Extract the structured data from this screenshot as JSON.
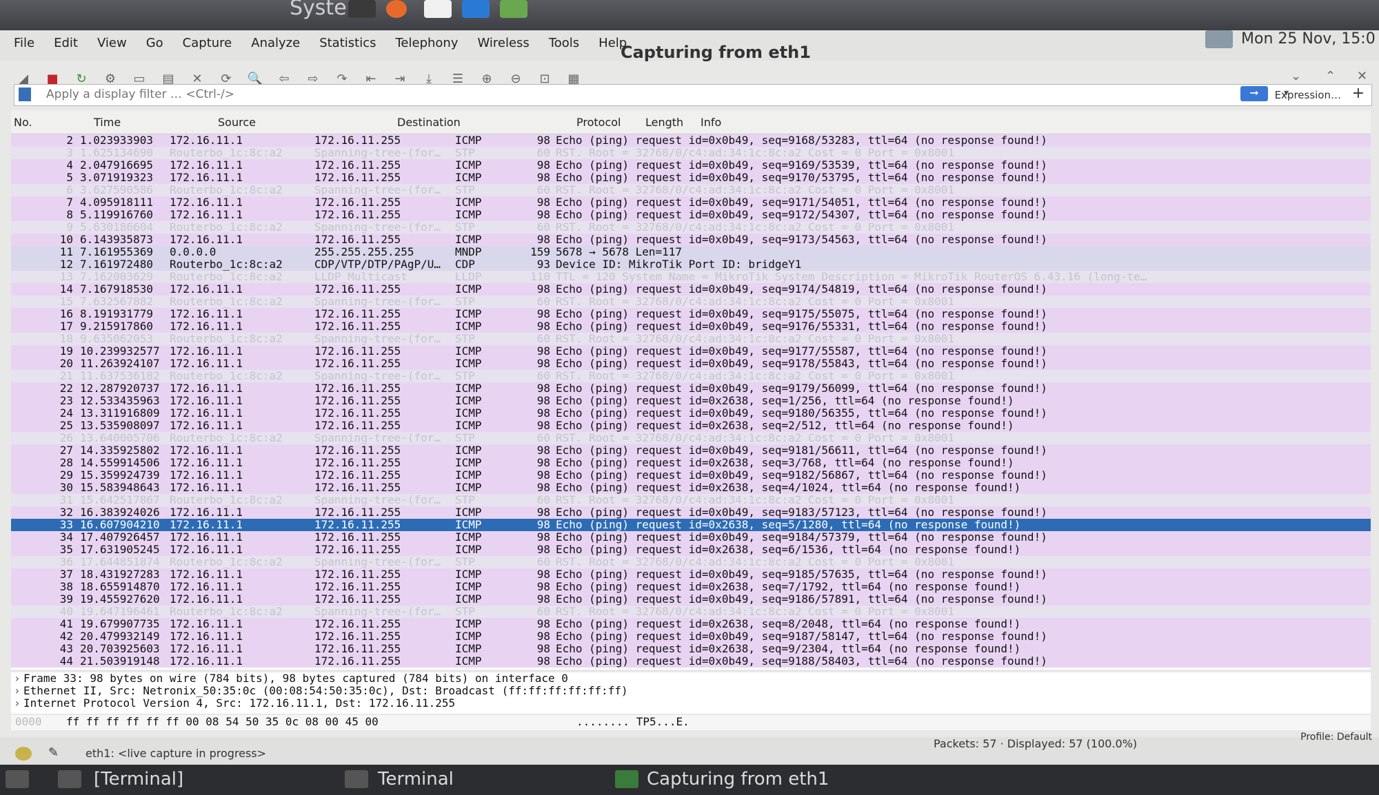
{
  "topbar": {
    "app_title": "System",
    "clock": "Mon 25 Nov, 15:0"
  },
  "window": {
    "title": "Capturing from eth1",
    "menu": [
      "File",
      "Edit",
      "View",
      "Go",
      "Capture",
      "Analyze",
      "Statistics",
      "Telephony",
      "Wireless",
      "Tools",
      "Help"
    ]
  },
  "filter": {
    "placeholder": "Apply a display filter … <Ctrl-/>",
    "expression_label": "Expression…",
    "plus_label": "+"
  },
  "columns": {
    "no": "No.",
    "time": "Time",
    "source": "Source",
    "destination": "Destination",
    "protocol": "Protocol",
    "length": "Length",
    "info": "Info"
  },
  "packets": [
    {
      "no": "2",
      "time": "1.023933903",
      "src": "172.16.11.1",
      "dst": "172.16.11.255",
      "proto": "ICMP",
      "len": "98",
      "info": "Echo (ping) request  id=0x0b49, seq=9168/53283, ttl=64 (no response found!)",
      "kind": "icmp"
    },
    {
      "no": "3",
      "time": "1.625134690",
      "src": "Routerbo_1c:8c:a2",
      "dst": "Spanning-tree-(for…",
      "proto": "STP",
      "len": "60",
      "info": "RST. Root = 32768/0/c4:ad:34:1c:8c:a2  Cost = 0  Port = 0x8001",
      "kind": "stp"
    },
    {
      "no": "4",
      "time": "2.047916695",
      "src": "172.16.11.1",
      "dst": "172.16.11.255",
      "proto": "ICMP",
      "len": "98",
      "info": "Echo (ping) request  id=0x0b49, seq=9169/53539, ttl=64 (no response found!)",
      "kind": "icmp"
    },
    {
      "no": "5",
      "time": "3.071919323",
      "src": "172.16.11.1",
      "dst": "172.16.11.255",
      "proto": "ICMP",
      "len": "98",
      "info": "Echo (ping) request  id=0x0b49, seq=9170/53795, ttl=64 (no response found!)",
      "kind": "icmp"
    },
    {
      "no": "6",
      "time": "3.627590586",
      "src": "Routerbo_1c:8c:a2",
      "dst": "Spanning-tree-(for…",
      "proto": "STP",
      "len": "60",
      "info": "RST. Root = 32768/0/c4:ad:34:1c:8c:a2  Cost = 0  Port = 0x8001",
      "kind": "stp"
    },
    {
      "no": "7",
      "time": "4.095918111",
      "src": "172.16.11.1",
      "dst": "172.16.11.255",
      "proto": "ICMP",
      "len": "98",
      "info": "Echo (ping) request  id=0x0b49, seq=9171/54051, ttl=64 (no response found!)",
      "kind": "icmp"
    },
    {
      "no": "8",
      "time": "5.119916760",
      "src": "172.16.11.1",
      "dst": "172.16.11.255",
      "proto": "ICMP",
      "len": "98",
      "info": "Echo (ping) request  id=0x0b49, seq=9172/54307, ttl=64 (no response found!)",
      "kind": "icmp"
    },
    {
      "no": "9",
      "time": "5.630186604",
      "src": "Routerbo_1c:8c:a2",
      "dst": "Spanning-tree-(for…",
      "proto": "STP",
      "len": "60",
      "info": "RST. Root = 32768/0/c4:ad:34:1c:8c:a2  Cost = 0  Port = 0x8001",
      "kind": "stp"
    },
    {
      "no": "10",
      "time": "6.143935873",
      "src": "172.16.11.1",
      "dst": "172.16.11.255",
      "proto": "ICMP",
      "len": "98",
      "info": "Echo (ping) request  id=0x0b49, seq=9173/54563, ttl=64 (no response found!)",
      "kind": "icmp"
    },
    {
      "no": "11",
      "time": "7.161955369",
      "src": "0.0.0.0",
      "dst": "255.255.255.255",
      "proto": "MNDP",
      "len": "159",
      "info": "5678 → 5678 Len=117",
      "kind": "mndp"
    },
    {
      "no": "12",
      "time": "7.161972480",
      "src": "Routerbo_1c:8c:a2",
      "dst": "CDP/VTP/DTP/PAgP/U…",
      "proto": "CDP",
      "len": "93",
      "info": "Device ID: MikroTik  Port ID: bridgeY1",
      "kind": "cdp"
    },
    {
      "no": "13",
      "time": "7.162003629",
      "src": "Routerbo_1c:8c:a2",
      "dst": "LLDP_Multicast",
      "proto": "LLDP",
      "len": "110",
      "info": "TTL = 120 System Name = MikroTik System Description = MikroTik RouterOS 6.43.16 (long-te…",
      "kind": "lldp"
    },
    {
      "no": "14",
      "time": "7.167918530",
      "src": "172.16.11.1",
      "dst": "172.16.11.255",
      "proto": "ICMP",
      "len": "98",
      "info": "Echo (ping) request  id=0x0b49, seq=9174/54819, ttl=64 (no response found!)",
      "kind": "icmp"
    },
    {
      "no": "15",
      "time": "7.632567882",
      "src": "Routerbo_1c:8c:a2",
      "dst": "Spanning-tree-(for…",
      "proto": "STP",
      "len": "60",
      "info": "RST. Root = 32768/0/c4:ad:34:1c:8c:a2  Cost = 0  Port = 0x8001",
      "kind": "stp"
    },
    {
      "no": "16",
      "time": "8.191931779",
      "src": "172.16.11.1",
      "dst": "172.16.11.255",
      "proto": "ICMP",
      "len": "98",
      "info": "Echo (ping) request  id=0x0b49, seq=9175/55075, ttl=64 (no response found!)",
      "kind": "icmp"
    },
    {
      "no": "17",
      "time": "9.215917860",
      "src": "172.16.11.1",
      "dst": "172.16.11.255",
      "proto": "ICMP",
      "len": "98",
      "info": "Echo (ping) request  id=0x0b49, seq=9176/55331, ttl=64 (no response found!)",
      "kind": "icmp"
    },
    {
      "no": "18",
      "time": "9.635062053",
      "src": "Routerbo_1c:8c:a2",
      "dst": "Spanning-tree-(for…",
      "proto": "STP",
      "len": "60",
      "info": "RST. Root = 32768/0/c4:ad:34:1c:8c:a2  Cost = 0  Port = 0x8001",
      "kind": "stp"
    },
    {
      "no": "19",
      "time": "10.239932577",
      "src": "172.16.11.1",
      "dst": "172.16.11.255",
      "proto": "ICMP",
      "len": "98",
      "info": "Echo (ping) request  id=0x0b49, seq=9177/55587, ttl=64 (no response found!)",
      "kind": "icmp"
    },
    {
      "no": "20",
      "time": "11.263924107",
      "src": "172.16.11.1",
      "dst": "172.16.11.255",
      "proto": "ICMP",
      "len": "98",
      "info": "Echo (ping) request  id=0x0b49, seq=9178/55843, ttl=64 (no response found!)",
      "kind": "icmp"
    },
    {
      "no": "21",
      "time": "11.637536182",
      "src": "Routerbo_1c:8c:a2",
      "dst": "Spanning-tree-(for…",
      "proto": "STP",
      "len": "60",
      "info": "RST. Root = 32768/0/c4:ad:34:1c:8c:a2  Cost = 0  Port = 0x8001",
      "kind": "stp"
    },
    {
      "no": "22",
      "time": "12.287920737",
      "src": "172.16.11.1",
      "dst": "172.16.11.255",
      "proto": "ICMP",
      "len": "98",
      "info": "Echo (ping) request  id=0x0b49, seq=9179/56099, ttl=64 (no response found!)",
      "kind": "icmp"
    },
    {
      "no": "23",
      "time": "12.533435963",
      "src": "172.16.11.1",
      "dst": "172.16.11.255",
      "proto": "ICMP",
      "len": "98",
      "info": "Echo (ping) request  id=0x2638, seq=1/256, ttl=64 (no response found!)",
      "kind": "icmp"
    },
    {
      "no": "24",
      "time": "13.311916809",
      "src": "172.16.11.1",
      "dst": "172.16.11.255",
      "proto": "ICMP",
      "len": "98",
      "info": "Echo (ping) request  id=0x0b49, seq=9180/56355, ttl=64 (no response found!)",
      "kind": "icmp"
    },
    {
      "no": "25",
      "time": "13.535908097",
      "src": "172.16.11.1",
      "dst": "172.16.11.255",
      "proto": "ICMP",
      "len": "98",
      "info": "Echo (ping) request  id=0x2638, seq=2/512, ttl=64 (no response found!)",
      "kind": "icmp"
    },
    {
      "no": "26",
      "time": "13.640005706",
      "src": "Routerbo_1c:8c:a2",
      "dst": "Spanning-tree-(for…",
      "proto": "STP",
      "len": "60",
      "info": "RST. Root = 32768/0/c4:ad:34:1c:8c:a2  Cost = 0  Port = 0x8001",
      "kind": "stp"
    },
    {
      "no": "27",
      "time": "14.335925802",
      "src": "172.16.11.1",
      "dst": "172.16.11.255",
      "proto": "ICMP",
      "len": "98",
      "info": "Echo (ping) request  id=0x0b49, seq=9181/56611, ttl=64 (no response found!)",
      "kind": "icmp"
    },
    {
      "no": "28",
      "time": "14.559914506",
      "src": "172.16.11.1",
      "dst": "172.16.11.255",
      "proto": "ICMP",
      "len": "98",
      "info": "Echo (ping) request  id=0x2638, seq=3/768, ttl=64 (no response found!)",
      "kind": "icmp"
    },
    {
      "no": "29",
      "time": "15.359924739",
      "src": "172.16.11.1",
      "dst": "172.16.11.255",
      "proto": "ICMP",
      "len": "98",
      "info": "Echo (ping) request  id=0x0b49, seq=9182/56867, ttl=64 (no response found!)",
      "kind": "icmp"
    },
    {
      "no": "30",
      "time": "15.583948643",
      "src": "172.16.11.1",
      "dst": "172.16.11.255",
      "proto": "ICMP",
      "len": "98",
      "info": "Echo (ping) request  id=0x2638, seq=4/1024, ttl=64 (no response found!)",
      "kind": "icmp"
    },
    {
      "no": "31",
      "time": "15.642517867",
      "src": "Routerbo_1c:8c:a2",
      "dst": "Spanning-tree-(for…",
      "proto": "STP",
      "len": "60",
      "info": "RST. Root = 32768/0/c4:ad:34:1c:8c:a2  Cost = 0  Port = 0x8001",
      "kind": "stp"
    },
    {
      "no": "32",
      "time": "16.383924026",
      "src": "172.16.11.1",
      "dst": "172.16.11.255",
      "proto": "ICMP",
      "len": "98",
      "info": "Echo (ping) request  id=0x0b49, seq=9183/57123, ttl=64 (no response found!)",
      "kind": "icmp"
    },
    {
      "no": "33",
      "time": "16.607904210",
      "src": "172.16.11.1",
      "dst": "172.16.11.255",
      "proto": "ICMP",
      "len": "98",
      "info": "Echo (ping) request  id=0x2638, seq=5/1280, ttl=64 (no response found!)",
      "kind": "sel"
    },
    {
      "no": "34",
      "time": "17.407926457",
      "src": "172.16.11.1",
      "dst": "172.16.11.255",
      "proto": "ICMP",
      "len": "98",
      "info": "Echo (ping) request  id=0x0b49, seq=9184/57379, ttl=64 (no response found!)",
      "kind": "icmp"
    },
    {
      "no": "35",
      "time": "17.631905245",
      "src": "172.16.11.1",
      "dst": "172.16.11.255",
      "proto": "ICMP",
      "len": "98",
      "info": "Echo (ping) request  id=0x2638, seq=6/1536, ttl=64 (no response found!)",
      "kind": "icmp"
    },
    {
      "no": "36",
      "time": "17.644851874",
      "src": "Routerbo_1c:8c:a2",
      "dst": "Spanning-tree-(for…",
      "proto": "STP",
      "len": "60",
      "info": "RST. Root = 32768/0/c4:ad:34:1c:8c:a2  Cost = 0  Port = 0x8001",
      "kind": "stp"
    },
    {
      "no": "37",
      "time": "18.431927283",
      "src": "172.16.11.1",
      "dst": "172.16.11.255",
      "proto": "ICMP",
      "len": "98",
      "info": "Echo (ping) request  id=0x0b49, seq=9185/57635, ttl=64 (no response found!)",
      "kind": "icmp"
    },
    {
      "no": "38",
      "time": "18.655914870",
      "src": "172.16.11.1",
      "dst": "172.16.11.255",
      "proto": "ICMP",
      "len": "98",
      "info": "Echo (ping) request  id=0x2638, seq=7/1792, ttl=64 (no response found!)",
      "kind": "icmp"
    },
    {
      "no": "39",
      "time": "19.455927620",
      "src": "172.16.11.1",
      "dst": "172.16.11.255",
      "proto": "ICMP",
      "len": "98",
      "info": "Echo (ping) request  id=0x0b49, seq=9186/57891, ttl=64 (no response found!)",
      "kind": "icmp"
    },
    {
      "no": "40",
      "time": "19.647196461",
      "src": "Routerbo_1c:8c:a2",
      "dst": "Spanning-tree-(for…",
      "proto": "STP",
      "len": "60",
      "info": "RST. Root = 32768/0/c4:ad:34:1c:8c:a2  Cost = 0  Port = 0x8001",
      "kind": "stp"
    },
    {
      "no": "41",
      "time": "19.679907735",
      "src": "172.16.11.1",
      "dst": "172.16.11.255",
      "proto": "ICMP",
      "len": "98",
      "info": "Echo (ping) request  id=0x2638, seq=8/2048, ttl=64 (no response found!)",
      "kind": "icmp"
    },
    {
      "no": "42",
      "time": "20.479932149",
      "src": "172.16.11.1",
      "dst": "172.16.11.255",
      "proto": "ICMP",
      "len": "98",
      "info": "Echo (ping) request  id=0x0b49, seq=9187/58147, ttl=64 (no response found!)",
      "kind": "icmp"
    },
    {
      "no": "43",
      "time": "20.703925603",
      "src": "172.16.11.1",
      "dst": "172.16.11.255",
      "proto": "ICMP",
      "len": "98",
      "info": "Echo (ping) request  id=0x2638, seq=9/2304, ttl=64 (no response found!)",
      "kind": "icmp"
    },
    {
      "no": "44",
      "time": "21.503919148",
      "src": "172.16.11.1",
      "dst": "172.16.11.255",
      "proto": "ICMP",
      "len": "98",
      "info": "Echo (ping) request  id=0x0b49, seq=9188/58403, ttl=64 (no response found!)",
      "kind": "icmp"
    }
  ],
  "details": [
    "Frame 33: 98 bytes on wire (784 bits), 98 bytes captured (784 bits) on interface 0",
    "Ethernet II, Src: Netronix_50:35:0c (00:08:54:50:35:0c), Dst: Broadcast (ff:ff:ff:ff:ff:ff)",
    "Internet Protocol Version 4, Src: 172.16.11.1, Dst: 172.16.11.255"
  ],
  "bytes": {
    "offset": "0000",
    "hex": "ff ff ff ff ff ff 00 08  54 50 35 0c 08 00 45 00",
    "ascii": "........ TP5...E."
  },
  "status": {
    "message": "eth1: <live capture in progress>",
    "packets": "Packets: 57 · Displayed: 57 (100.0%)",
    "profile": "Profile: Default"
  },
  "taskbar": {
    "item1": "[Terminal]",
    "item2": "Terminal",
    "item3": "Capturing from eth1"
  }
}
